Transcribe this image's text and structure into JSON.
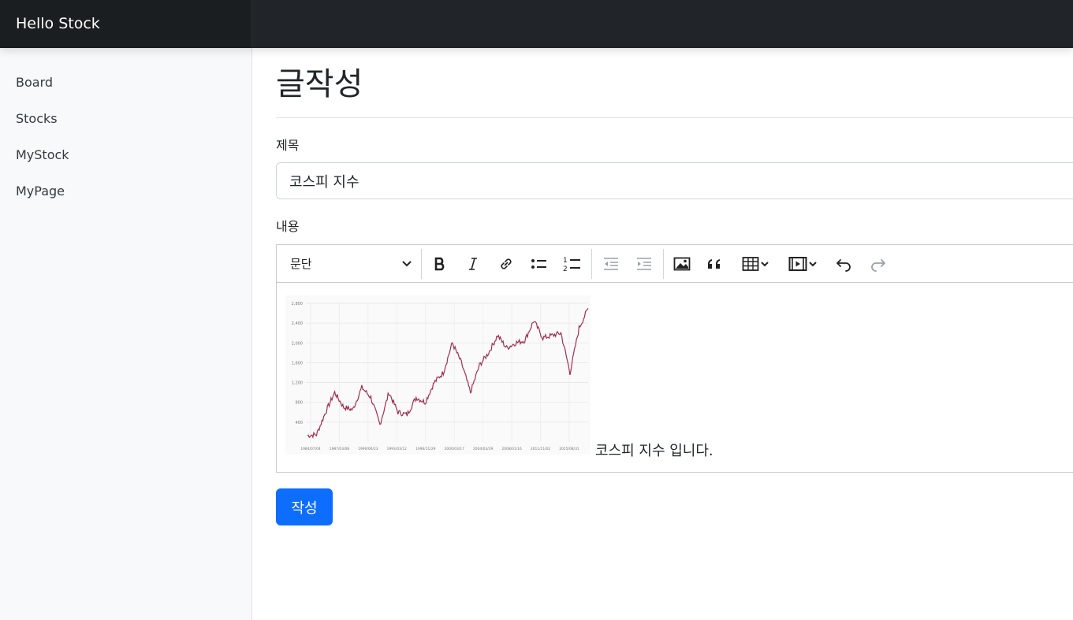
{
  "app": {
    "brand": "Hello Stock"
  },
  "sidebar": {
    "items": [
      {
        "label": "Board"
      },
      {
        "label": "Stocks"
      },
      {
        "label": "MyStock"
      },
      {
        "label": "MyPage"
      }
    ]
  },
  "page": {
    "title": "글작성"
  },
  "form": {
    "title_label": "제목",
    "title_value": "코스피 지수",
    "content_label": "내용",
    "submit_label": "작성"
  },
  "editor": {
    "paragraph_format": "문단",
    "toolbar_icons": [
      "bold-icon",
      "italic-icon",
      "link-icon",
      "bulleted-list-icon",
      "numbered-list-icon",
      "outdent-icon",
      "indent-icon",
      "image-icon",
      "blockquote-icon",
      "table-icon",
      "media-icon",
      "undo-icon",
      "redo-icon"
    ],
    "body_text": "코스피 지수 입니다.",
    "embedded_chart": {
      "y_ticks": [
        "2,800",
        "2,400",
        "2,000",
        "1,600",
        "1,200",
        "800",
        "400"
      ],
      "x_ticks": [
        "1984/07/04",
        "1987/03/08",
        "1990/06/23",
        "1993/03/12",
        "1996/11/29",
        "2000/03/17",
        "2004/03/29",
        "2008/01/16",
        "2011/11/02",
        "2015/08/31"
      ]
    }
  },
  "chart_data": {
    "type": "line",
    "x": [
      "1984",
      "1986",
      "1988",
      "1989",
      "1990",
      "1992",
      "1994",
      "1996",
      "1998",
      "1999",
      "2000",
      "2001",
      "2002",
      "2004",
      "2005",
      "2006",
      "2007",
      "2008",
      "2008.5",
      "2009",
      "2010",
      "2011",
      "2012",
      "2014",
      "2016",
      "2017",
      "2018",
      "2019",
      "2020",
      "2020.3",
      "2020.8",
      "2021"
    ],
    "series": [
      {
        "values": [
          130,
          150,
          600,
          1000,
          700,
          650,
          1100,
          900,
          350,
          1000,
          600,
          550,
          900,
          800,
          1200,
          1400,
          2000,
          1600,
          1000,
          1550,
          1800,
          2150,
          1900,
          2000,
          2050,
          2450,
          2100,
          2150,
          2200,
          1400,
          2300,
          2700
        ]
      }
    ],
    "ylim": [
      0,
      2800
    ],
    "grid": true,
    "color": "#a03050"
  }
}
